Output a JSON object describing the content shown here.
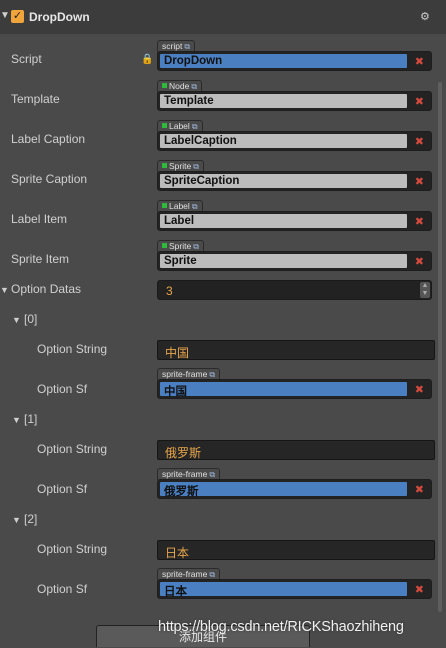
{
  "component": {
    "title": "DropDown",
    "enabled": true
  },
  "properties": {
    "script": {
      "label": "Script",
      "type": "script",
      "value": "DropDown"
    },
    "template": {
      "label": "Template",
      "type": "Node",
      "value": "Template"
    },
    "label_caption": {
      "label": "Label Caption",
      "type": "Label",
      "value": "LabelCaption"
    },
    "sprite_caption": {
      "label": "Sprite Caption",
      "type": "Sprite",
      "value": "SpriteCaption"
    },
    "label_item": {
      "label": "Label Item",
      "type": "Label",
      "value": "Label"
    },
    "sprite_item": {
      "label": "Sprite Item",
      "type": "Sprite",
      "value": "Sprite"
    }
  },
  "option_datas": {
    "label": "Option Datas",
    "count": "3",
    "items": [
      {
        "index": "[0]",
        "string_label": "Option String",
        "string_value": "中国",
        "sf_label": "Option Sf",
        "sf_type": "sprite-frame",
        "sf_value": "中国"
      },
      {
        "index": "[1]",
        "string_label": "Option String",
        "string_value": "俄罗斯",
        "sf_label": "Option Sf",
        "sf_type": "sprite-frame",
        "sf_value": "俄罗斯"
      },
      {
        "index": "[2]",
        "string_label": "Option String",
        "string_value": "日本",
        "sf_label": "Option Sf",
        "sf_type": "sprite-frame",
        "sf_value": "日本"
      }
    ]
  },
  "footer": {
    "add_component": "添加组件",
    "watermark": "https://blog.csdn.net/RICKShaozhiheng"
  },
  "colors": {
    "accent": "#f1a43a",
    "ref_blue": "#4a7fc1",
    "clear_red": "#d44a3c",
    "value_orange": "#e8a64a"
  }
}
